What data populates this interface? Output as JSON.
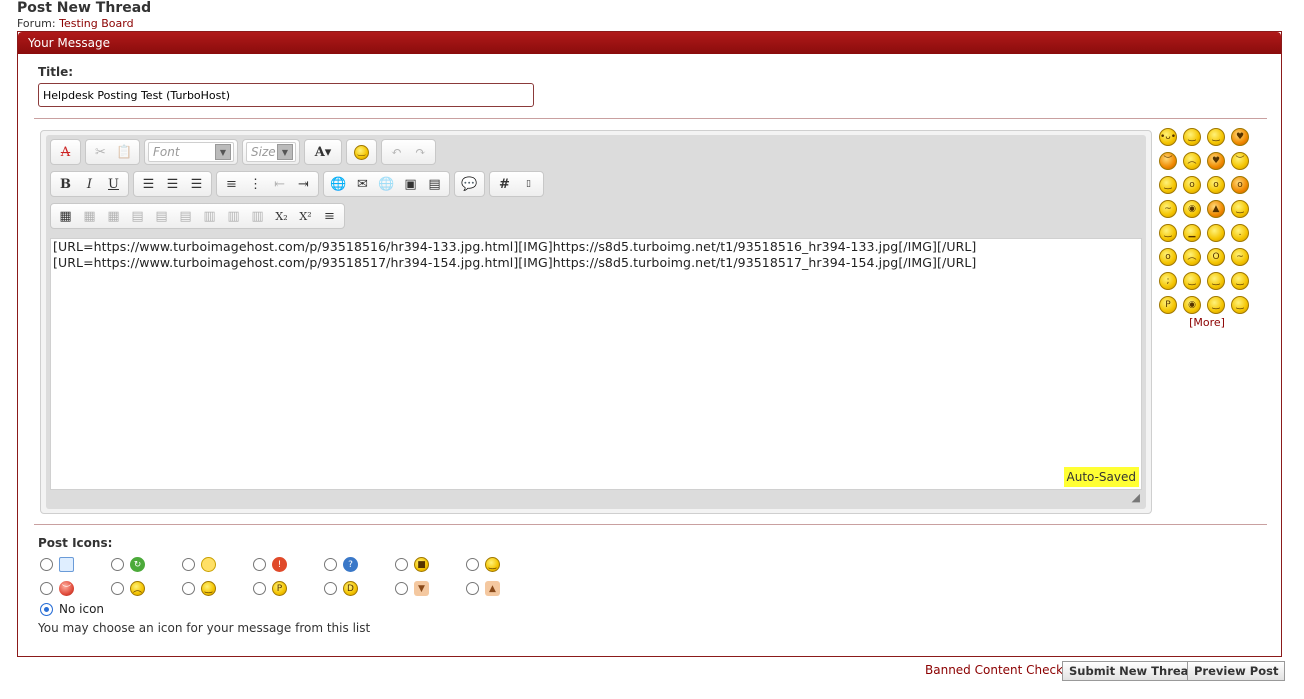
{
  "header": {
    "title": "Post New Thread",
    "forum_prefix": "Forum:",
    "forum_name": "Testing Board"
  },
  "panel": {
    "title": "Your Message"
  },
  "title_field": {
    "label": "Title:",
    "value": "Helpdesk Posting Test (TurboHost)"
  },
  "editor": {
    "font_placeholder": "Font",
    "size_placeholder": "Size",
    "lines": [
      "[URL=https://www.turboimagehost.com/p/93518516/hr394-133.jpg.html][IMG]https://s8d5.turboimg.net/t1/93518516_hr394-133.jpg[/IMG][/URL]",
      "[URL=https://www.turboimagehost.com/p/93518517/hr394-154.jpg.html][IMG]https://s8d5.turboimg.net/t1/93518517_hr394-154.jpg[/IMG][/URL]"
    ],
    "autosaved": "Auto-Saved"
  },
  "smilies": {
    "more": "[More]"
  },
  "post_icons": {
    "label": "Post Icons:",
    "no_icon": "No icon",
    "hint": "You may choose an icon for your message from this list"
  },
  "footer": {
    "banned_check": "Banned Content Check",
    "submit": "Submit New Thread",
    "preview": "Preview Post"
  },
  "colors": {
    "accent": "#8b0000",
    "highlight": "#ffff33"
  }
}
